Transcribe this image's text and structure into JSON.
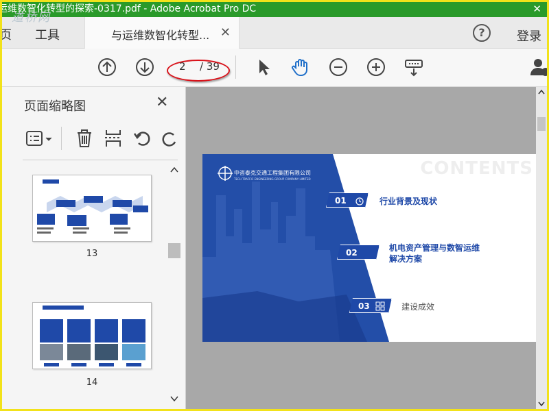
{
  "window": {
    "title": "运维数智化转型的探索-0317.pdf - Adobe Acrobat Pro DC",
    "watermark": "道桥网"
  },
  "tabs": {
    "home": "页",
    "tools": "工具",
    "document": "与运维数智化转型...",
    "help": "?",
    "login": "登录"
  },
  "toolbar": {
    "current_page": "2",
    "total_pages": "/ 39"
  },
  "thumbnail_pane": {
    "title": "页面缩略图",
    "thumbnails": [
      {
        "number": "13"
      },
      {
        "number": "14"
      }
    ]
  },
  "slide": {
    "company": "中咨泰克交通工程集团有限公司",
    "company_en": "TECH TRAFFIC ENGINEERING GROUP COMPANY LIMITED",
    "contents_word": "CONTENTS",
    "items": [
      {
        "num": "01",
        "label": "行业背景及现状"
      },
      {
        "num": "02",
        "label_line1": "机电资产管理与数智运维",
        "label_line2": "解决方案"
      },
      {
        "num": "03",
        "label": "建设成效"
      }
    ]
  },
  "colors": {
    "titlebar": "#2a9a2a",
    "frame": "#f2e21a",
    "accent_blue": "#1f49a8",
    "annotation_red": "#d9121a"
  }
}
